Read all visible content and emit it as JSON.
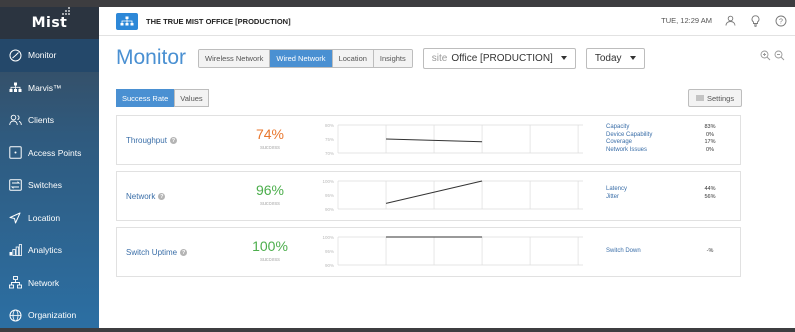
{
  "colors": {
    "accent": "#4a90d2",
    "orange": "#e8772e",
    "green": "#4cae4c",
    "sidebar_top": "#3a4756",
    "sidebar_bottom": "#2c6fa3"
  },
  "sidebar": {
    "logo": "Mist",
    "items": [
      {
        "label": "Monitor",
        "icon": "monitor-icon"
      },
      {
        "label": "Marvis™",
        "icon": "marvis-icon"
      },
      {
        "label": "Clients",
        "icon": "clients-icon"
      },
      {
        "label": "Access Points",
        "icon": "access-point-icon"
      },
      {
        "label": "Switches",
        "icon": "switch-icon"
      },
      {
        "label": "Location",
        "icon": "location-icon"
      },
      {
        "label": "Analytics",
        "icon": "analytics-icon"
      },
      {
        "label": "Network",
        "icon": "network-icon"
      },
      {
        "label": "Organization",
        "icon": "organization-icon"
      }
    ]
  },
  "topbar": {
    "org_title": "THE TRUE MIST OFFICE [PRODUCTION]",
    "datetime": "TUE, 12:29 AM"
  },
  "header": {
    "title": "Monitor",
    "tabs": [
      "Wireless Network",
      "Wired Network",
      "Location",
      "Insights"
    ],
    "active_tab": "Wired Network",
    "site_label": "site",
    "site_value": "Office [PRODUCTION]",
    "time_value": "Today"
  },
  "subtoolbar": {
    "buttons": [
      "Success Rate",
      "Values"
    ],
    "active": "Success Rate",
    "settings": "Settings"
  },
  "metrics": [
    {
      "name": "Throughput",
      "percent": "74%",
      "sub": "success",
      "color": "#e8772e",
      "ticks": [
        "80%",
        "75%",
        "70%"
      ],
      "line": [
        75,
        74
      ],
      "ylim": [
        70,
        80
      ],
      "details": [
        "Capacity",
        "Device Capability",
        "Coverage",
        "Network Issues"
      ],
      "values": [
        "83%",
        "0%",
        "17%",
        "0%"
      ]
    },
    {
      "name": "Network",
      "percent": "96%",
      "sub": "success",
      "color": "#4cae4c",
      "ticks": [
        "100%",
        "95%",
        "90%"
      ],
      "line": [
        92,
        100
      ],
      "ylim": [
        90,
        100
      ],
      "details": [
        "Latency",
        "Jitter"
      ],
      "values": [
        "44%",
        "56%"
      ]
    },
    {
      "name": "Switch Uptime",
      "percent": "100%",
      "sub": "success",
      "color": "#4cae4c",
      "ticks": [
        "100%",
        "95%",
        "90%"
      ],
      "line": [
        100,
        100
      ],
      "ylim": [
        90,
        100
      ],
      "details": [
        "Switch Down"
      ],
      "values": [
        "-%"
      ]
    }
  ]
}
